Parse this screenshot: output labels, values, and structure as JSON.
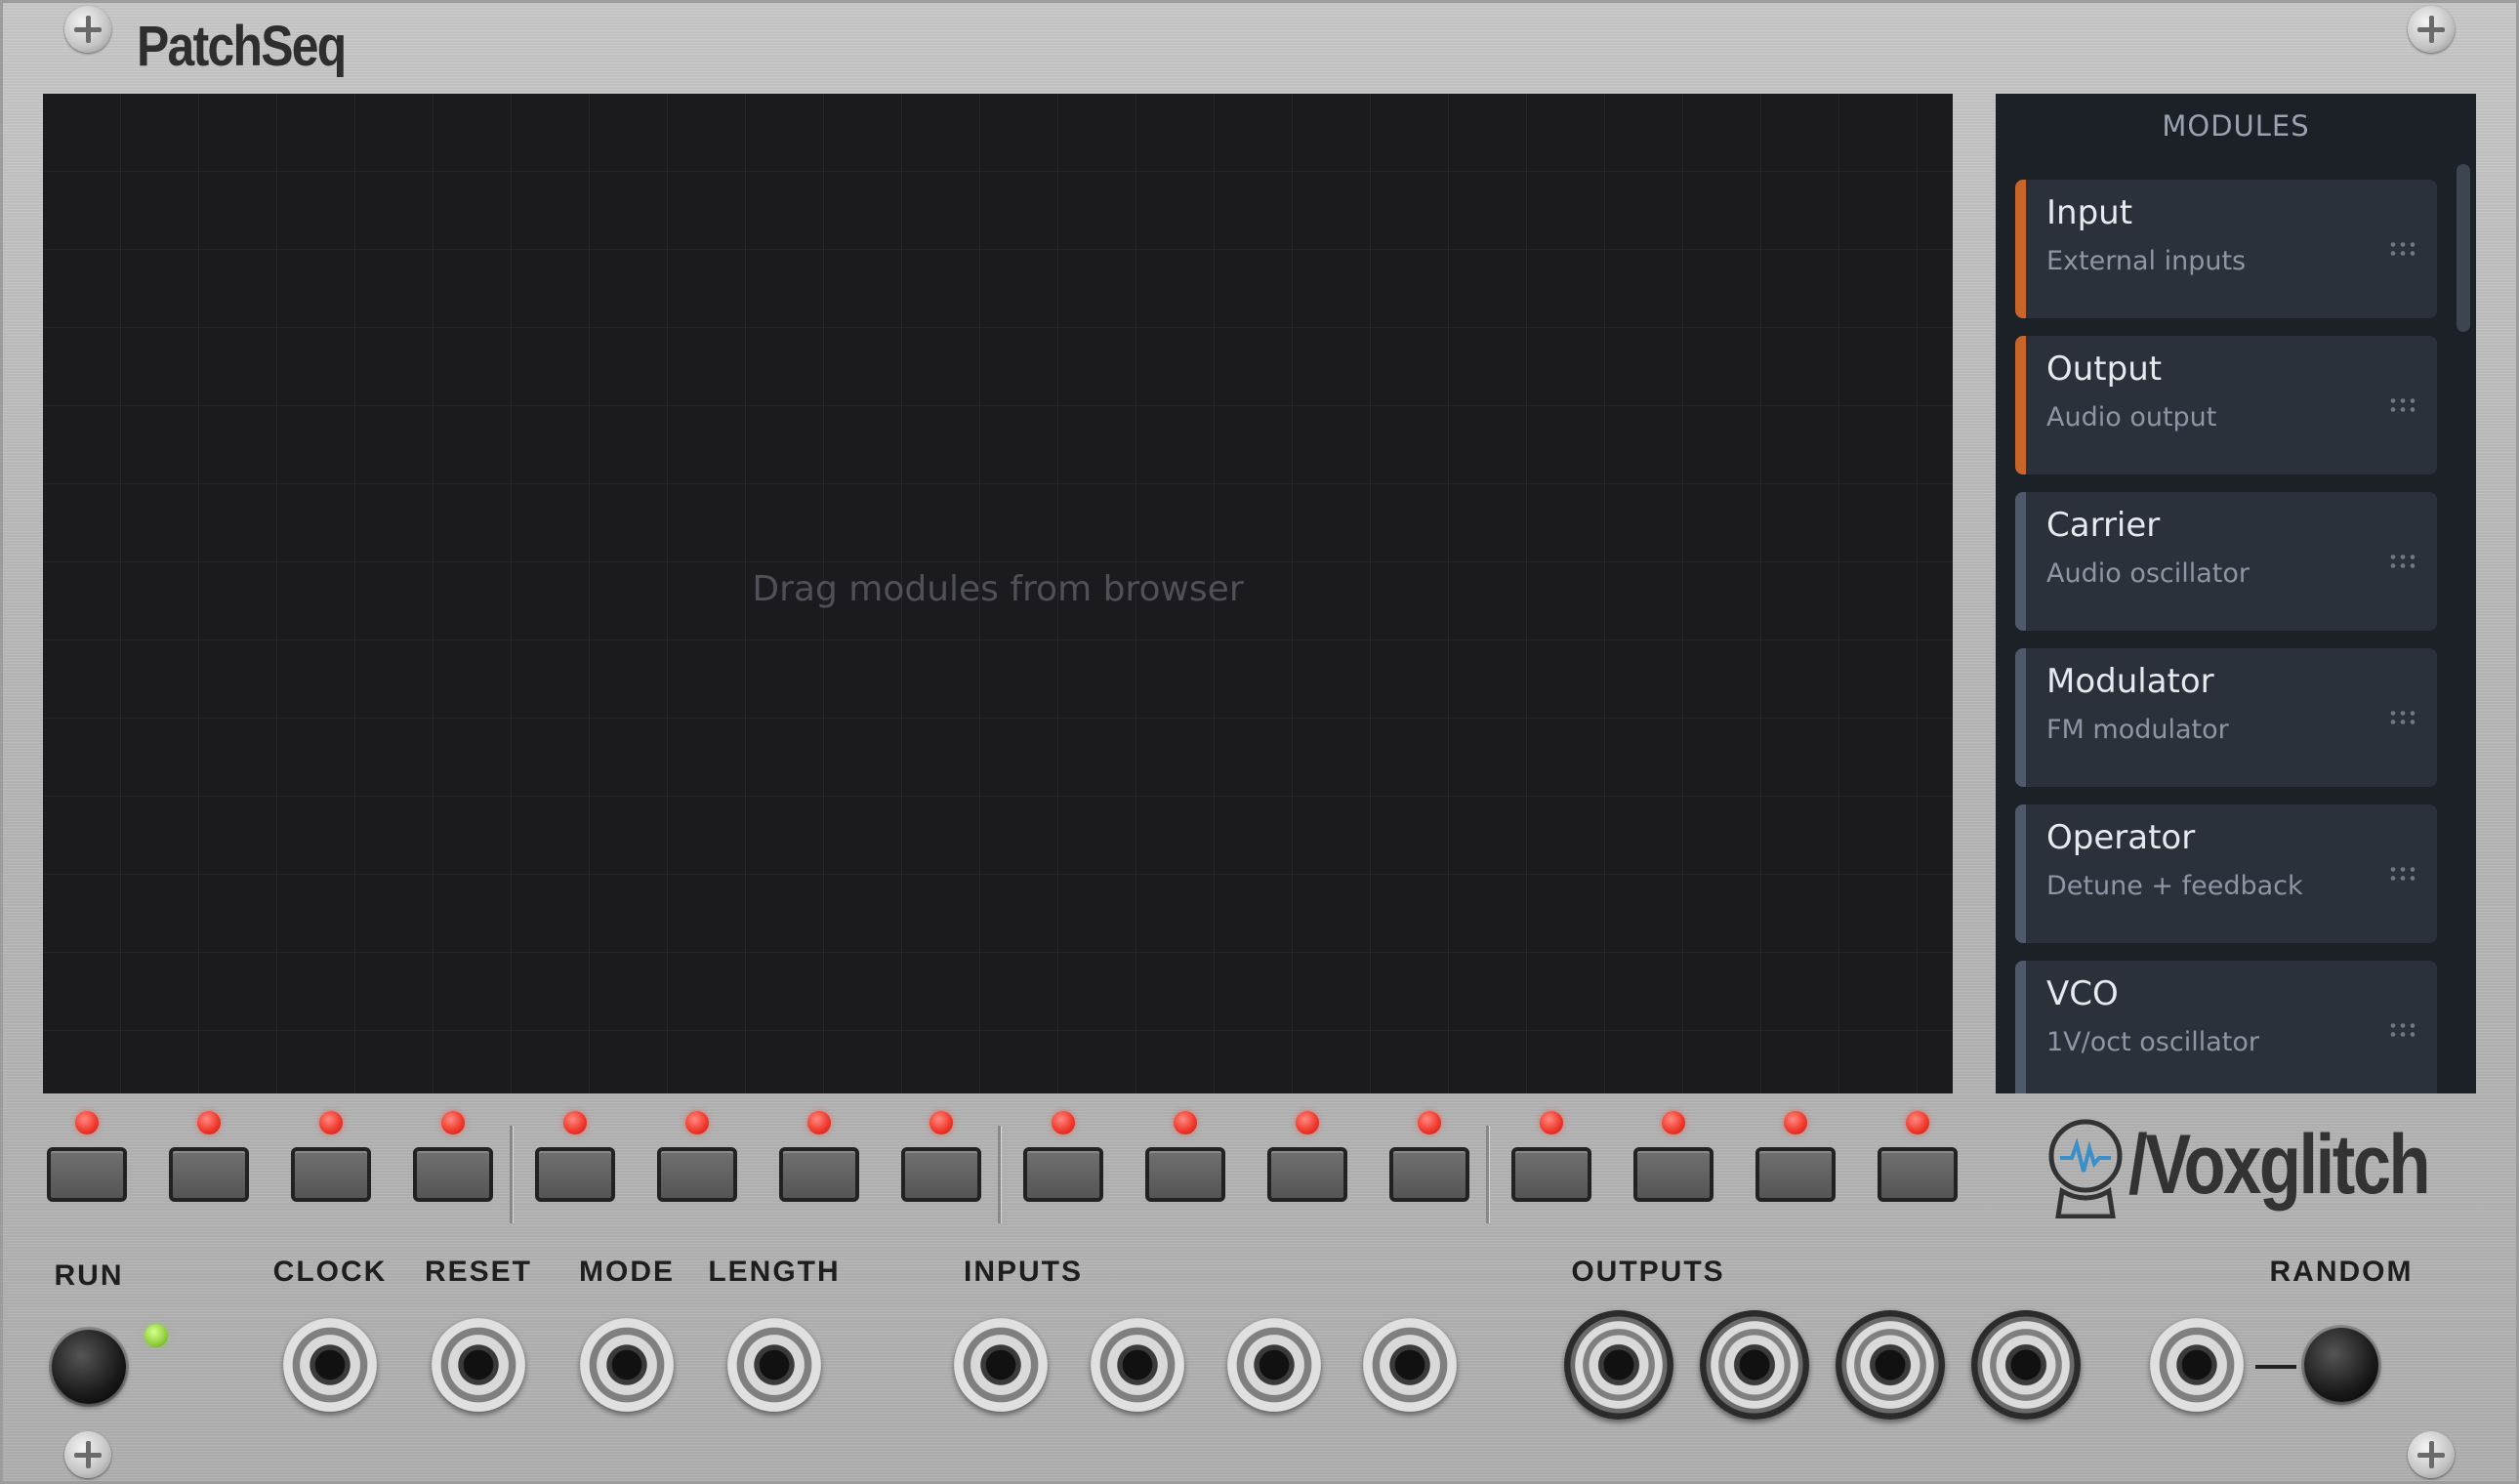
{
  "app": {
    "title": "PatchSeq",
    "brand": "/Voxglitch"
  },
  "canvas": {
    "hint": "Drag modules from browser"
  },
  "browser": {
    "title": "MODULES",
    "modules": [
      {
        "name": "Input",
        "desc": "External inputs",
        "color": "#c8652a"
      },
      {
        "name": "Output",
        "desc": "Audio output",
        "color": "#c8652a"
      },
      {
        "name": "Carrier",
        "desc": "Audio oscillator",
        "color": "#4e5a6a"
      },
      {
        "name": "Modulator",
        "desc": "FM modulator",
        "color": "#4e5a6a"
      },
      {
        "name": "Operator",
        "desc": "Detune + feedback",
        "color": "#4e5a6a"
      },
      {
        "name": "VCO",
        "desc": "1V/oct oscillator",
        "color": "#4e5a6a"
      }
    ]
  },
  "steps": {
    "count": 16,
    "led_color": "#f23a2e",
    "active": [
      true,
      true,
      true,
      true,
      true,
      true,
      true,
      true,
      true,
      true,
      true,
      true,
      true,
      true,
      true,
      true
    ]
  },
  "labels": {
    "run": "RUN",
    "clock": "CLOCK",
    "reset": "RESET",
    "mode": "MODE",
    "length": "LENGTH",
    "inputs": "INPUTS",
    "outputs": "OUTPUTS",
    "random": "RANDOM"
  },
  "run_led": {
    "on": true,
    "color": "#8fce3a"
  }
}
